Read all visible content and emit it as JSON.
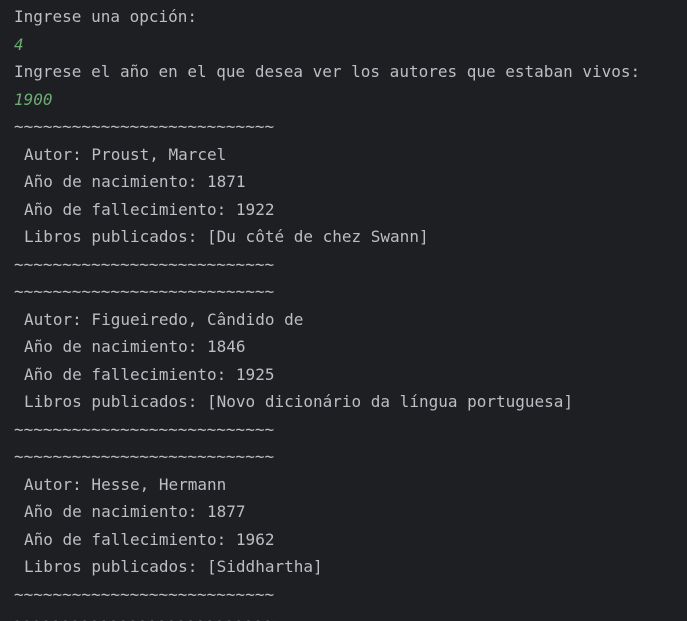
{
  "console": {
    "prompt_option": "Ingrese una opción:",
    "input_option": "4",
    "prompt_year": "Ingrese el año en el que desea ver los autores que estaban vivos:",
    "input_year": "1900",
    "separator": "~~~~~~~~~~~~~~~~~~~~~~~~~~~",
    "colors": {
      "background": "#1e1f22",
      "text": "#bcbec4",
      "user_input": "#6aab73"
    },
    "authors": [
      {
        "autor": "Autor: Proust, Marcel",
        "nacimiento": "Año de nacimiento: 1871",
        "fallecimiento": "Año de fallecimiento: 1922",
        "libros": "Libros publicados: [Du côté de chez Swann]"
      },
      {
        "autor": "Autor: Figueiredo, Cândido de",
        "nacimiento": "Año de nacimiento: 1846",
        "fallecimiento": "Año de fallecimiento: 1925",
        "libros": "Libros publicados: [Novo dicionário da língua portuguesa]"
      },
      {
        "autor": "Autor: Hesse, Hermann",
        "nacimiento": "Año de nacimiento: 1877",
        "fallecimiento": "Año de fallecimiento: 1962",
        "libros": "Libros publicados: [Siddhartha]"
      }
    ]
  }
}
